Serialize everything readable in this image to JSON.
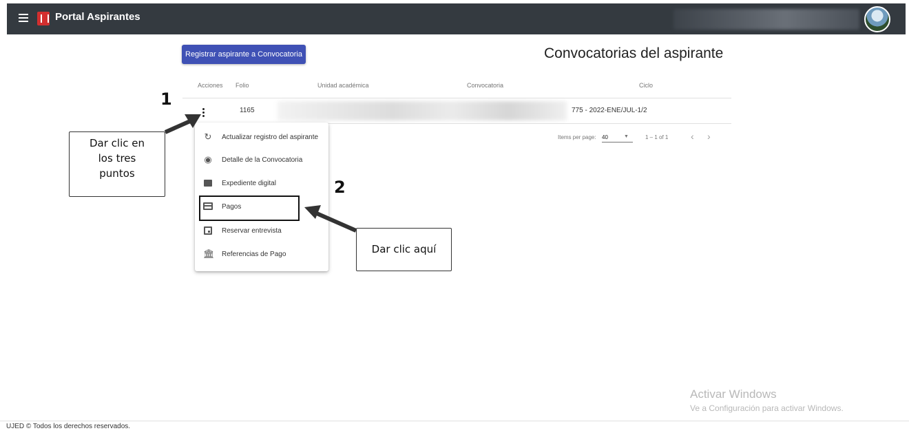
{
  "header": {
    "brand_title": "Portal Aspirantes"
  },
  "main": {
    "register_button_label": "Registrar aspirante a Convocatoria",
    "page_title": "Convocatorias del aspirante",
    "table": {
      "columns": [
        "Acciones",
        "Folio",
        "Unidad académica",
        "Convocatoria",
        "Ciclo"
      ],
      "rows": [
        {
          "folio": "1165",
          "ciclo": "775 - 2022-ENE/JUL-1/2"
        }
      ]
    },
    "paginator": {
      "items_per_page_label": "Items per page:",
      "page_size": "40",
      "range_label": "1 – 1 of 1",
      "prev_glyph": "‹",
      "next_glyph": "›"
    }
  },
  "actions_menu": {
    "items": [
      {
        "label": "Actualizar registro del aspirante",
        "icon": "refresh-icon"
      },
      {
        "label": "Detalle de la Convocatoria",
        "icon": "eye-icon"
      },
      {
        "label": "Expediente digital",
        "icon": "folder-icon"
      },
      {
        "label": "Pagos",
        "icon": "credit-card-icon"
      },
      {
        "label": "Reservar entrevista",
        "icon": "calendar-icon"
      },
      {
        "label": "Referencias de Pago",
        "icon": "bank-icon"
      }
    ]
  },
  "annotations": {
    "step1_number": "1",
    "step1_text": [
      "Dar clic en",
      "los tres",
      "puntos"
    ],
    "step2_number": "2",
    "step2_text": "Dar clic aquí"
  },
  "watermark": {
    "title": "Activar Windows",
    "subtitle": "Ve a Configuración para activar Windows."
  },
  "footer": {
    "text": "UJED © Todos los derechos reservados."
  },
  "colors": {
    "toolbar": "#343a40",
    "primary_button": "#3f51b5",
    "brand_logo": "#d32f2f"
  }
}
